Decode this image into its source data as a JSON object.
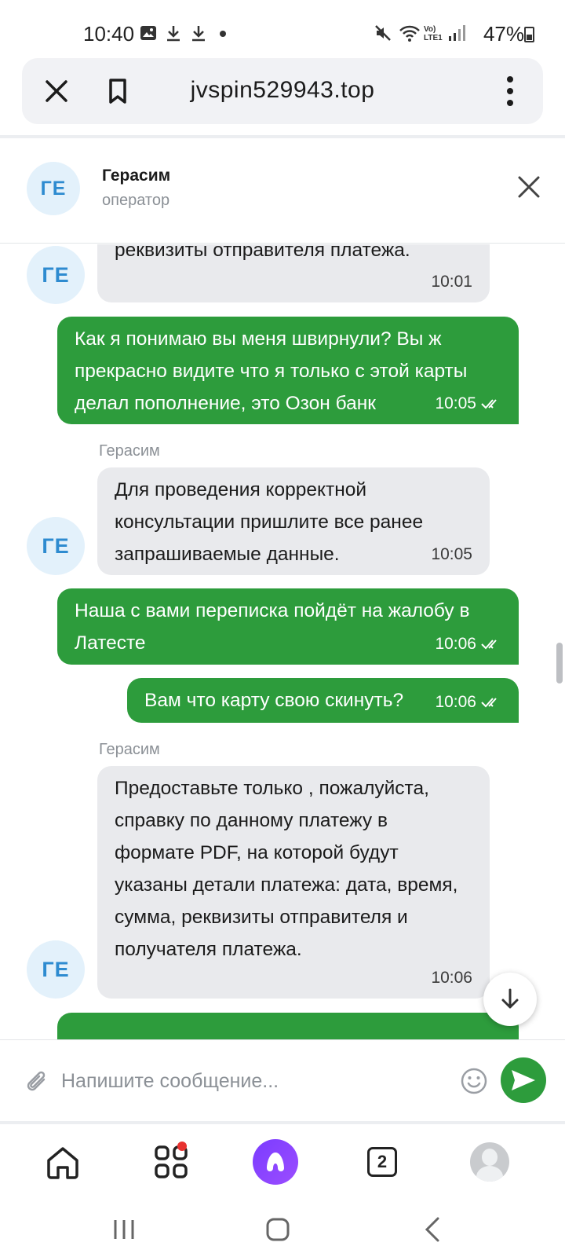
{
  "status_bar": {
    "time": "10:40",
    "battery": "47%",
    "network": "Vo) LTE1",
    "icons": [
      "gallery-icon",
      "download-icon",
      "download-icon",
      "dot-icon",
      "mute-icon",
      "wifi-icon",
      "signal-icon",
      "battery-icon"
    ]
  },
  "browser": {
    "url": "jvspin529943.top",
    "icons": [
      "close-icon",
      "bookmark-icon",
      "more-vert-icon"
    ]
  },
  "chat_header": {
    "avatar": "ГЕ",
    "name": "Герасим",
    "role": "оператор"
  },
  "messages": [
    {
      "side": "in",
      "avatar": "ГЕ",
      "text": "реквизиты отправителя платежа.",
      "time": "10:01"
    },
    {
      "side": "out",
      "text": "Как я понимаю вы меня швирнули? Вы ж прекрасно видите что я только с этой карты делал пополнение, это Озон банк",
      "time": "10:05",
      "read": true
    },
    {
      "side": "in",
      "sender": "Герасим",
      "avatar": "ГЕ",
      "text": "Для проведения корректной консультации пришлите все ранее запрашиваемые данные.",
      "time": "10:05"
    },
    {
      "side": "out",
      "text": "Наша с вами переписка пойдёт на жалобу в Латесте",
      "time": "10:06",
      "read": true
    },
    {
      "side": "out",
      "text": "Вам что карту свою скинуть?",
      "time": "10:06",
      "read": true
    },
    {
      "side": "in",
      "sender": "Герасим",
      "avatar": "ГЕ",
      "text": "Предоставьте только , пожалуйста, справку по данному платежу в формате PDF, на которой будут указаны детали платежа: дата, время, сумма, реквизиты отправителя и получателя платежа.",
      "time": "10:06"
    }
  ],
  "input": {
    "placeholder": "Напишите сообщение..."
  },
  "app_nav": {
    "tabs_count": "2",
    "icons": [
      "home-icon",
      "services-icon",
      "alice-icon",
      "tabs-icon",
      "profile-icon"
    ]
  },
  "colors": {
    "accent_green": "#2d9c3c",
    "incoming_bubble": "#e9eaed",
    "avatar_bg": "#e3f1fb",
    "avatar_text": "#2e8bd0",
    "alice_purple": "#8a44ff"
  }
}
